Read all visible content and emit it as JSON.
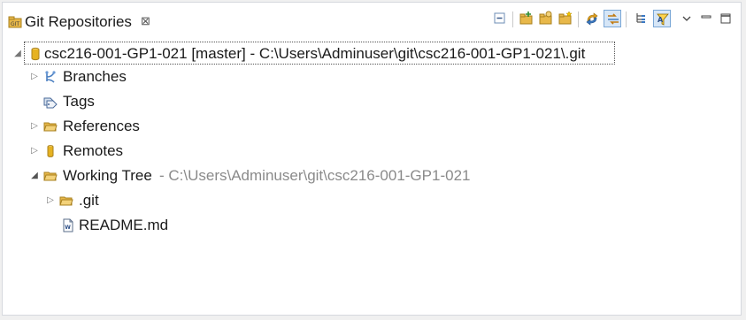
{
  "view": {
    "tab_title": "Git Repositories",
    "tab_close": "⊠"
  },
  "toolbar": {
    "buttons": [
      {
        "name": "collapse-all",
        "icon": "collapse-all-icon"
      },
      {
        "name": "add-existing-repository",
        "icon": "add-repository-icon"
      },
      {
        "name": "clone-repository",
        "icon": "clone-repository-icon"
      },
      {
        "name": "create-repository",
        "icon": "create-repository-icon"
      },
      {
        "name": "refresh",
        "icon": "refresh-icon"
      },
      {
        "name": "link-with-selection",
        "icon": "link-with-editor-icon",
        "pressed": true
      },
      {
        "name": "hierarchical-layout",
        "icon": "hierarchy-icon"
      },
      {
        "name": "filter",
        "icon": "filter-icon",
        "pressed": true
      },
      {
        "name": "view-menu",
        "icon": "chevron-down-icon"
      },
      {
        "name": "minimize",
        "icon": "minimize-icon"
      },
      {
        "name": "maximize",
        "icon": "maximize-icon"
      }
    ]
  },
  "tree": {
    "repository": {
      "label": "csc216-001-GP1-021 [master] - C:\\Users\\Adminuser\\git\\csc216-001-GP1-021\\.git",
      "expanded": true
    },
    "branches": {
      "label": "Branches"
    },
    "tags": {
      "label": "Tags"
    },
    "references": {
      "label": "References"
    },
    "remotes": {
      "label": "Remotes"
    },
    "working_tree": {
      "label": "Working Tree",
      "path": "- C:\\Users\\Adminuser\\git\\csc216-001-GP1-021",
      "expanded": true
    },
    "git_folder": {
      "label": ".git"
    },
    "readme": {
      "label": "README.md"
    }
  },
  "colors": {
    "folder": "#e8b84a",
    "repo_cylinder": "#e6b222",
    "selection_border": "#555555",
    "path_text": "#8a8a8a",
    "pressed_bg": "#d6e6f7"
  }
}
